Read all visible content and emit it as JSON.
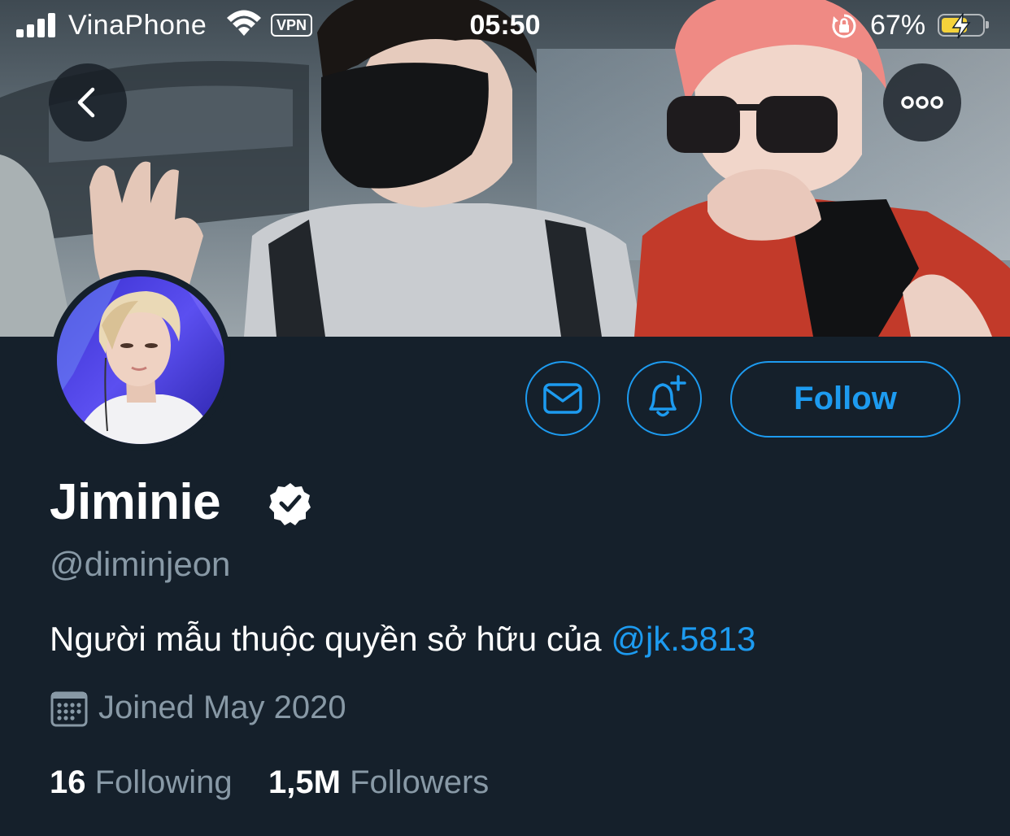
{
  "status_bar": {
    "carrier": "VinaPhone",
    "vpn": "VPN",
    "time": "05:50",
    "battery_percent": "67%",
    "battery_level": 0.67,
    "signal_bars": 4
  },
  "profile": {
    "display_name": "Jiminie",
    "handle": "@diminjeon",
    "bio_text": "Người mẫu thuộc quyền sở hữu của ",
    "bio_mention": "@jk.5813",
    "joined": "Joined May 2020",
    "following_count": "16",
    "following_label": "Following",
    "followers_count": "1,5M",
    "followers_label": "Followers",
    "verified": true
  },
  "actions": {
    "follow_label": "Follow"
  },
  "icons": {
    "back": "chevron-left-icon",
    "more": "more-horizontal-icon",
    "message": "envelope-icon",
    "notify": "bell-plus-icon",
    "verified": "verified-badge-icon",
    "calendar": "calendar-icon"
  },
  "colors": {
    "background": "#15202b",
    "accent": "#1d9bf0",
    "secondary_text": "#8899a6",
    "battery_fill": "#f5d33b"
  }
}
